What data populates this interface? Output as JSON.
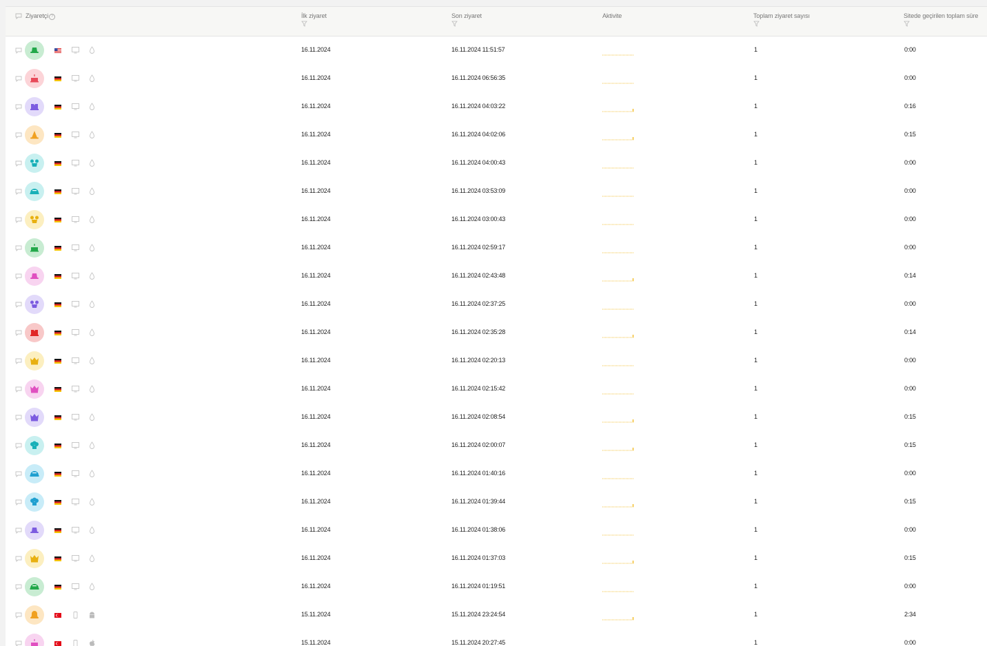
{
  "columns": {
    "visitor": "Ziyaretçi",
    "first_visit": "İlk ziyaret",
    "last_visit": "Son ziyaret",
    "activity": "Aktivite",
    "total_visits": "Toplam ziyaret sayısı",
    "total_time": "Sitede geçirilen toplam süre"
  },
  "rows": [
    {
      "avatar": "hat",
      "color": "#22a84a",
      "bg": "#c8ecd2",
      "flag": "us",
      "device": "desktop",
      "os": "other",
      "first": "16.11.2024",
      "last": "16.11.2024 11:51:57",
      "spike": 0,
      "visits": "1",
      "time": "0:00"
    },
    {
      "avatar": "cake",
      "color": "#e84a5a",
      "bg": "#fcd4d8",
      "flag": "de",
      "device": "desktop",
      "os": "other",
      "first": "16.11.2024",
      "last": "16.11.2024 06:56:35",
      "spike": 0,
      "visits": "1",
      "time": "0:00"
    },
    {
      "avatar": "cap",
      "color": "#7c5ce0",
      "bg": "#e2dafa",
      "flag": "de",
      "device": "desktop",
      "os": "other",
      "first": "16.11.2024",
      "last": "16.11.2024 04:03:22",
      "spike": 1,
      "visits": "1",
      "time": "0:16"
    },
    {
      "avatar": "cone",
      "color": "#f0a020",
      "bg": "#fde6c2",
      "flag": "de",
      "device": "desktop",
      "os": "other",
      "first": "16.11.2024",
      "last": "16.11.2024 04:02:06",
      "spike": 1,
      "visits": "1",
      "time": "0:15"
    },
    {
      "avatar": "mouse",
      "color": "#18b0b8",
      "bg": "#c8f0f0",
      "flag": "de",
      "device": "desktop",
      "os": "other",
      "first": "16.11.2024",
      "last": "16.11.2024 04:00:43",
      "spike": 0,
      "visits": "1",
      "time": "0:00"
    },
    {
      "avatar": "helmet",
      "color": "#18b0b8",
      "bg": "#c8f0f0",
      "flag": "de",
      "device": "desktop",
      "os": "other",
      "first": "16.11.2024",
      "last": "16.11.2024 03:53:09",
      "spike": 0,
      "visits": "1",
      "time": "0:00"
    },
    {
      "avatar": "mouse",
      "color": "#e8b010",
      "bg": "#fcefc0",
      "flag": "de",
      "device": "desktop",
      "os": "other",
      "first": "16.11.2024",
      "last": "16.11.2024 03:00:43",
      "spike": 0,
      "visits": "1",
      "time": "0:00"
    },
    {
      "avatar": "cake",
      "color": "#22a84a",
      "bg": "#c8ecd2",
      "flag": "de",
      "device": "desktop",
      "os": "other",
      "first": "16.11.2024",
      "last": "16.11.2024 02:59:17",
      "spike": 0,
      "visits": "1",
      "time": "0:00"
    },
    {
      "avatar": "hat",
      "color": "#e050c0",
      "bg": "#f8d4f0",
      "flag": "de",
      "device": "desktop",
      "os": "other",
      "first": "16.11.2024",
      "last": "16.11.2024 02:43:48",
      "spike": 1,
      "visits": "1",
      "time": "0:14"
    },
    {
      "avatar": "mouse",
      "color": "#7c5ce0",
      "bg": "#e2dafa",
      "flag": "de",
      "device": "desktop",
      "os": "other",
      "first": "16.11.2024",
      "last": "16.11.2024 02:37:25",
      "spike": 0,
      "visits": "1",
      "time": "0:00"
    },
    {
      "avatar": "cap",
      "color": "#e02828",
      "bg": "#f8c8c8",
      "flag": "de",
      "device": "desktop",
      "os": "other",
      "first": "16.11.2024",
      "last": "16.11.2024 02:35:28",
      "spike": 1,
      "visits": "1",
      "time": "0:14"
    },
    {
      "avatar": "crown",
      "color": "#e8b010",
      "bg": "#fcefc0",
      "flag": "de",
      "device": "desktop",
      "os": "other",
      "first": "16.11.2024",
      "last": "16.11.2024 02:20:13",
      "spike": 0,
      "visits": "1",
      "time": "0:00"
    },
    {
      "avatar": "crown",
      "color": "#e050c0",
      "bg": "#f8d4f0",
      "flag": "de",
      "device": "desktop",
      "os": "other",
      "first": "16.11.2024",
      "last": "16.11.2024 02:15:42",
      "spike": 0,
      "visits": "1",
      "time": "0:00"
    },
    {
      "avatar": "crown",
      "color": "#7c5ce0",
      "bg": "#e2dafa",
      "flag": "de",
      "device": "desktop",
      "os": "other",
      "first": "16.11.2024",
      "last": "16.11.2024 02:08:54",
      "spike": 1,
      "visits": "1",
      "time": "0:15"
    },
    {
      "avatar": "chef",
      "color": "#18b0b8",
      "bg": "#c8f0f0",
      "flag": "de",
      "device": "desktop",
      "os": "other",
      "first": "16.11.2024",
      "last": "16.11.2024 02:00:07",
      "spike": 1,
      "visits": "1",
      "time": "0:15"
    },
    {
      "avatar": "helmet",
      "color": "#20a0d0",
      "bg": "#c8ecf8",
      "flag": "de",
      "device": "desktop",
      "os": "other",
      "first": "16.11.2024",
      "last": "16.11.2024 01:40:16",
      "spike": 0,
      "visits": "1",
      "time": "0:00"
    },
    {
      "avatar": "chef",
      "color": "#20a0d0",
      "bg": "#c8ecf8",
      "flag": "de",
      "device": "desktop",
      "os": "other",
      "first": "16.11.2024",
      "last": "16.11.2024 01:39:44",
      "spike": 1,
      "visits": "1",
      "time": "0:15"
    },
    {
      "avatar": "hat",
      "color": "#7c5ce0",
      "bg": "#e2dafa",
      "flag": "de",
      "device": "desktop",
      "os": "other",
      "first": "16.11.2024",
      "last": "16.11.2024 01:38:06",
      "spike": 0,
      "visits": "1",
      "time": "0:00"
    },
    {
      "avatar": "crown",
      "color": "#e8b010",
      "bg": "#fcefc0",
      "flag": "de",
      "device": "desktop",
      "os": "other",
      "first": "16.11.2024",
      "last": "16.11.2024 01:37:03",
      "spike": 1,
      "visits": "1",
      "time": "0:15"
    },
    {
      "avatar": "helmet",
      "color": "#22a84a",
      "bg": "#c8ecd2",
      "flag": "de",
      "device": "desktop",
      "os": "other",
      "first": "16.11.2024",
      "last": "16.11.2024 01:19:51",
      "spike": 0,
      "visits": "1",
      "time": "0:00"
    },
    {
      "avatar": "bell",
      "color": "#f0a020",
      "bg": "#fde6c2",
      "flag": "tr",
      "device": "mobile",
      "os": "android",
      "first": "15.11.2024",
      "last": "15.11.2024 23:24:54",
      "spike": 1,
      "visits": "1",
      "time": "2:34"
    },
    {
      "avatar": "cake",
      "color": "#e050c0",
      "bg": "#f8d4f0",
      "flag": "tr",
      "device": "mobile",
      "os": "apple",
      "first": "15.11.2024",
      "last": "15.11.2024 20:27:45",
      "spike": 0,
      "visits": "1",
      "time": "0:00"
    }
  ]
}
